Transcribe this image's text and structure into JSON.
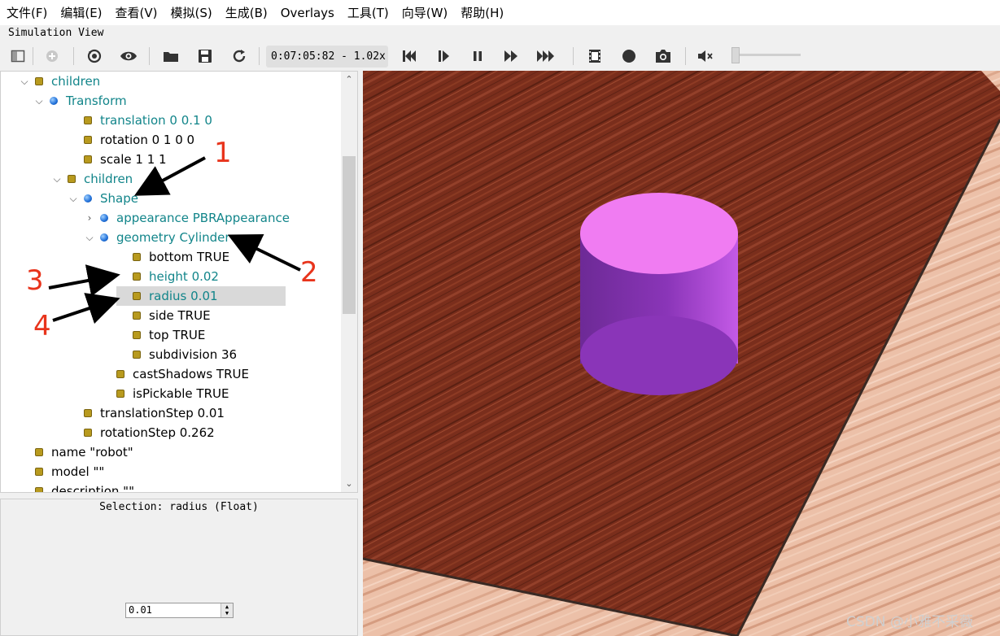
{
  "menu": [
    "文件(F)",
    "编辑(E)",
    "查看(V)",
    "模拟(S)",
    "生成(B)",
    "Overlays",
    "工具(T)",
    "向导(W)",
    "帮助(H)"
  ],
  "window_title": "Simulation View",
  "toolbar": {
    "time_display": "0:07:05:82 -  1.02x",
    "icons": [
      "toggle-panel-icon",
      "add-node-icon",
      "reset-view-icon",
      "eye-icon",
      "open-folder-icon",
      "save-icon",
      "reload-icon",
      "reset-simulation-icon",
      "step-icon",
      "pause-icon",
      "run-icon",
      "fast-forward-icon",
      "record-movie-icon",
      "record-icon",
      "screenshot-icon",
      "mute-icon"
    ],
    "volume_level": 0.0
  },
  "scene_tree": {
    "rows": [
      {
        "label": "children",
        "teal": true,
        "bullet": "yellow",
        "chevron": "down"
      },
      {
        "label": "Transform",
        "teal": true,
        "bullet": "blue",
        "chevron": "down"
      },
      {
        "label": "translation 0 0.1 0",
        "teal": true,
        "bullet": "yellow",
        "chevron": ""
      },
      {
        "label": "rotation 0 1 0 0",
        "teal": false,
        "bullet": "yellow",
        "chevron": ""
      },
      {
        "label": "scale 1 1 1",
        "teal": false,
        "bullet": "yellow",
        "chevron": ""
      },
      {
        "label": "children",
        "teal": true,
        "bullet": "yellow",
        "chevron": "down"
      },
      {
        "label": "Shape",
        "teal": true,
        "bullet": "blue",
        "chevron": "down"
      },
      {
        "label": "appearance PBRAppearance",
        "teal": true,
        "bullet": "blue",
        "chevron": "right"
      },
      {
        "label": "geometry Cylinder",
        "teal": true,
        "bullet": "blue",
        "chevron": "down"
      },
      {
        "label": "bottom TRUE",
        "teal": false,
        "bullet": "yellow",
        "chevron": ""
      },
      {
        "label": "height 0.02",
        "teal": true,
        "bullet": "yellow",
        "chevron": ""
      },
      {
        "label": "radius 0.01",
        "teal": true,
        "bullet": "yellow",
        "chevron": "",
        "selected": true
      },
      {
        "label": "side TRUE",
        "teal": false,
        "bullet": "yellow",
        "chevron": ""
      },
      {
        "label": "top TRUE",
        "teal": false,
        "bullet": "yellow",
        "chevron": ""
      },
      {
        "label": "subdivision 36",
        "teal": false,
        "bullet": "yellow",
        "chevron": ""
      },
      {
        "label": "castShadows TRUE",
        "teal": false,
        "bullet": "yellow",
        "chevron": ""
      },
      {
        "label": "isPickable TRUE",
        "teal": false,
        "bullet": "yellow",
        "chevron": ""
      },
      {
        "label": "translationStep 0.01",
        "teal": false,
        "bullet": "yellow",
        "chevron": ""
      },
      {
        "label": "rotationStep 0.262",
        "teal": false,
        "bullet": "yellow",
        "chevron": ""
      },
      {
        "label": "name \"robot\"",
        "teal": false,
        "bullet": "yellow",
        "chevron": ""
      },
      {
        "label": "model \"\"",
        "teal": false,
        "bullet": "yellow",
        "chevron": ""
      },
      {
        "label": "description \"\"",
        "teal": false,
        "bullet": "yellow",
        "chevron": ""
      }
    ]
  },
  "field_editor": {
    "selection_label": "Selection: radius (Float)",
    "value": "0.01"
  },
  "annotations": [
    "1",
    "2",
    "3",
    "4"
  ],
  "watermark": "CSDN @小雅不采薇",
  "colors": {
    "teal_text": "#12858a",
    "cylinder_top": "#f07cf2",
    "cylinder_side": "#8a35b8",
    "floor_dark": "#7a2e1c",
    "floor_light": "#e9b9a0"
  }
}
